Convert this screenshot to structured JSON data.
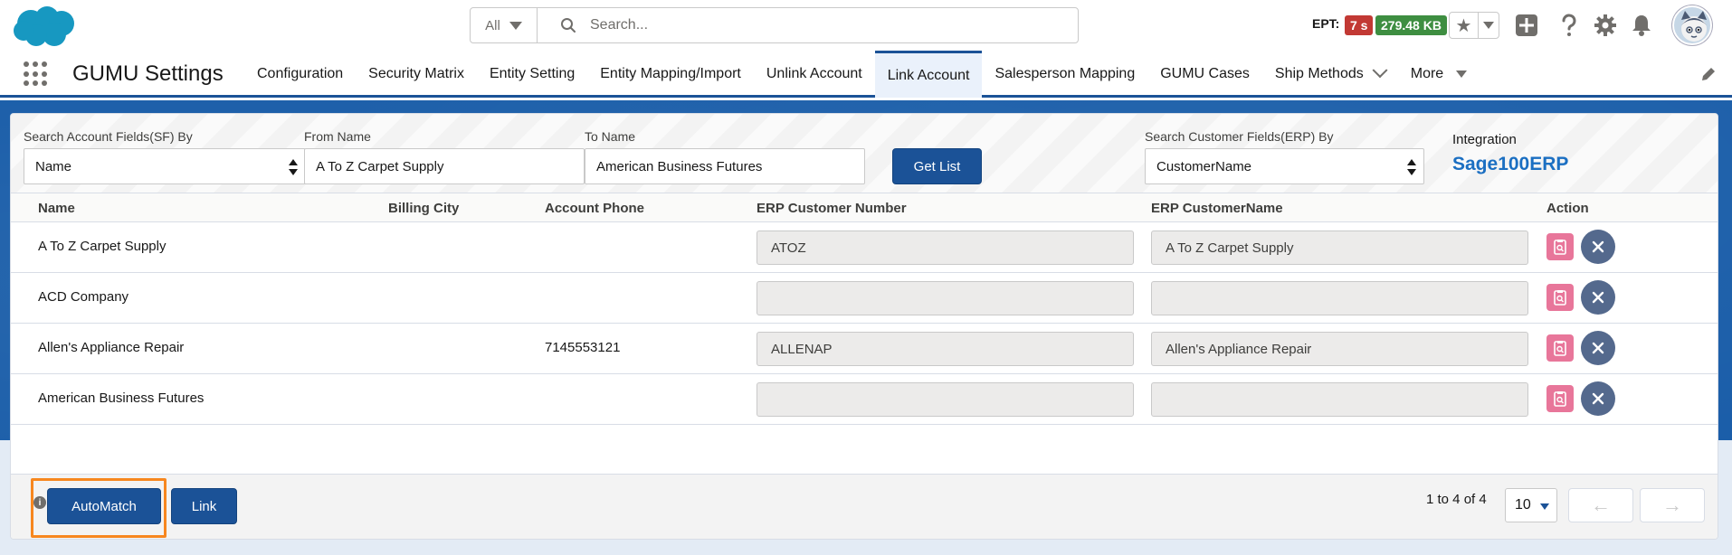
{
  "header": {
    "search": {
      "scope": "All",
      "placeholder": "Search..."
    },
    "ept_label": "EPT:",
    "ept_time": "7 s",
    "ept_size": "279.48 KB",
    "icons": [
      "favorites-star-icon",
      "add-icon",
      "help-icon",
      "setup-gear-icon",
      "notifications-bell-icon",
      "avatar"
    ]
  },
  "nav": {
    "app_name": "GUMU Settings",
    "tabs": [
      {
        "label": "Configuration"
      },
      {
        "label": "Security Matrix"
      },
      {
        "label": "Entity Setting"
      },
      {
        "label": "Entity Mapping/Import"
      },
      {
        "label": "Unlink Account"
      },
      {
        "label": "Link Account",
        "active": true
      },
      {
        "label": "Salesperson Mapping"
      },
      {
        "label": "GUMU Cases"
      },
      {
        "label": "Ship Methods"
      },
      {
        "label": "More"
      }
    ]
  },
  "filters": {
    "search_sf_label": "Search Account Fields(SF) By",
    "search_sf_value": "Name",
    "from_label": "From Name",
    "from_value": "A To Z Carpet Supply",
    "to_label": "To Name",
    "to_value": "American Business Futures",
    "get_list_label": "Get List",
    "search_erp_label": "Search Customer Fields(ERP) By",
    "search_erp_value": "CustomerName",
    "integration_label": "Integration",
    "integration_value": "Sage100ERP"
  },
  "table": {
    "columns": {
      "name": "Name",
      "billing_city": "Billing City",
      "phone": "Account Phone",
      "erp_number": "ERP Customer Number",
      "erp_name": "ERP CustomerName",
      "action": "Action"
    },
    "rows": [
      {
        "name": "A To Z Carpet Supply",
        "billing_city": "",
        "phone": "",
        "erp_number": "ATOZ",
        "erp_name": "A To Z Carpet Supply"
      },
      {
        "name": "ACD Company",
        "billing_city": "",
        "phone": "",
        "erp_number": "",
        "erp_name": ""
      },
      {
        "name": "Allen's Appliance Repair",
        "billing_city": "",
        "phone": "7145553121",
        "erp_number": "ALLENAP",
        "erp_name": "Allen's Appliance Repair"
      },
      {
        "name": "American Business Futures",
        "billing_city": "",
        "phone": "",
        "erp_number": "",
        "erp_name": ""
      }
    ]
  },
  "footer": {
    "automatch_label": "AutoMatch",
    "link_label": "Link",
    "pager_text": "1 to 4 of 4",
    "page_size": "10",
    "prev_glyph": "←",
    "next_glyph": "→"
  },
  "colors": {
    "brand": "#1b5297",
    "highlight": "#f7871f",
    "badge_red": "#c23934",
    "badge_green": "#3e8e41"
  }
}
